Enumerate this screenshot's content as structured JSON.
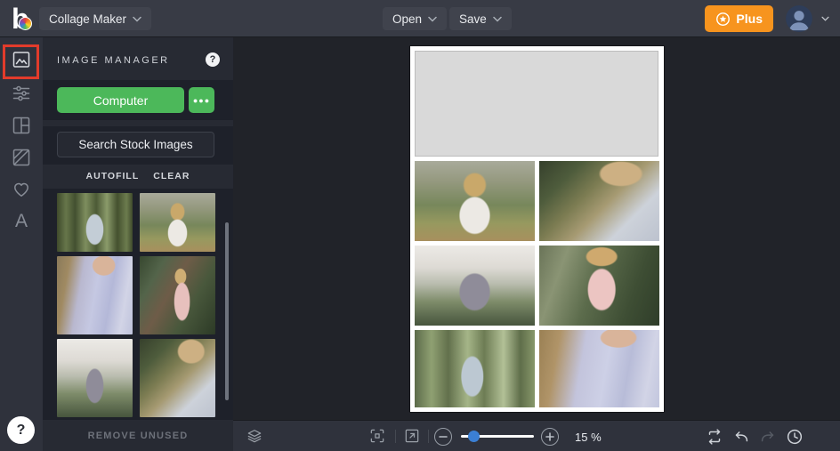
{
  "colors": {
    "accent_green": "#4CB85A",
    "plus_orange": "#F7941E",
    "annotation_red": "#E23B2B",
    "slider_blue": "#3B7FD4",
    "topbar_bg": "#383B45",
    "panel_bg": "#272A33",
    "panel_strip_bg": "#1E212A",
    "canvas_bg": "#212329"
  },
  "topbar": {
    "logo_letter": "b",
    "app_menu_label": "Collage Maker",
    "open_label": "Open",
    "save_label": "Save",
    "plus_label": "Plus"
  },
  "sidebar": {
    "items": [
      {
        "id": "image-manager",
        "active": true
      },
      {
        "id": "edit-adjust",
        "active": false
      },
      {
        "id": "layouts",
        "active": false
      },
      {
        "id": "backgrounds",
        "active": false
      },
      {
        "id": "graphics",
        "active": false
      },
      {
        "id": "text",
        "active": false,
        "glyph": "A"
      }
    ],
    "help_label": "?"
  },
  "image_manager": {
    "title": "IMAGE MANAGER",
    "help_label": "?",
    "computer_label": "Computer",
    "more_label": "●●●",
    "search_stock_label": "Search Stock Images",
    "autofill_label": "AUTOFILL",
    "clear_label": "CLEAR",
    "remove_unused_label": "REMOVE UNUSED",
    "thumbnails": [
      {
        "label": "woman-pale-blue-dress-in-forest",
        "style": "background:radial-gradient(ellipse 20% 45% at 50% 62%, #c3cdd6 0%, #c3cdd6 55%, rgba(195,205,214,0) 60%), linear-gradient(90deg, #3f4a2c 0%, #66764a 12%, #435030 24%, #7e8e5e 38%, #4c5a36 52%, #8a9a6a 66%, #44512f 80%, #6c7c4e 92%, #3f4a2c 100%)"
      },
      {
        "label": "blonde-woman-white-dress-field",
        "style": "background:radial-gradient(ellipse 22% 40% at 50% 68%, #ece9e4 0%, #ece9e4 55%, rgba(236,233,228,0) 60%), radial-gradient(ellipse 10% 16% at 50% 32%, #c9a86a 0%, #c9a86a 85%, rgba(201,168,106,0) 100%), linear-gradient(180deg, #a8aa9a 0%, #95997f 25%, #77875b 55%, #97995f 78%, #a8905e 100%)"
      },
      {
        "label": "lavender-off-shoulder-dress-back",
        "style": "background:radial-gradient(ellipse 26% 22% at 62% 12%, #d9b49a 0%, #d9b49a 55%, rgba(217,180,154,0) 60%), linear-gradient(100deg, #8a7a5a 0%, #a08a62 15%, #b9b8cf 32%, #c5c8e2 50%, #b4b8d8 68%, #d2d4e6 85%, #bfc3dc 100%)"
      },
      {
        "label": "blonde-woman-pink-dress-greenery",
        "style": "background:radial-gradient(ellipse 18% 42% at 56% 58%, #e7c0bd 0%, #e7c0bd 55%, rgba(231,192,189,0) 60%), radial-gradient(ellipse 12% 16% at 54% 26%, #cfae74 0%, #cfae74 60%, rgba(207,174,116,0) 66%), linear-gradient(120deg, #37472f 0%, #53644a 22%, #6e5c48 42%, #49583c 66%, #2c3a26 100%)"
      },
      {
        "label": "woman-gray-dress-under-white-dome",
        "style": "background:radial-gradient(ellipse 20% 38% at 50% 60%, #8f8c99 0%, #8f8c99 55%, rgba(143,140,153,0) 60%), linear-gradient(180deg, #eceae6 0%, #dddad4 28%, #b9bcae 48%, #7e8c6a 70%, #47553d 100%)"
      },
      {
        "label": "crossed-arms-lace-sleeves-white-dress",
        "style": "background:radial-gradient(ellipse 30% 26% at 68% 16%, #cdb083 0%, #cdb083 55%, rgba(205,176,131,0) 62%), linear-gradient(135deg, #36402c 0%, #4e5c3c 22%, #7c7c52 40%, #a69a72 55%, #cdd2da 75%, #bcc2ce 100%)"
      }
    ]
  },
  "canvas": {
    "collage": {
      "placeholder_label": "empty-image-slot",
      "cells": [
        {
          "label": "blonde-woman-white-dress-field",
          "style": "background:radial-gradient(ellipse 22% 40% at 50% 68%, #ece9e4 0%, #ece9e4 55%, rgba(236,233,228,0) 60%), radial-gradient(ellipse 10% 16% at 50% 30%, #c9a86a 0%, #c9a86a 85%, rgba(201,168,106,0) 100%), linear-gradient(180deg, #a8aa9a 0%, #95997f 25%, #77875b 55%, #97995f 78%, #a8905e 100%)"
        },
        {
          "label": "crossed-arms-lace-sleeves-white-dress",
          "style": "background:radial-gradient(ellipse 30% 26% at 68% 16%, #cdb083 0%, #cdb083 55%, rgba(205,176,131,0) 62%), linear-gradient(135deg, #36402c 0%, #4e5c3c 22%, #7c7c52 40%, #a69a72 55%, #cdd2da 75%, #bcc2ce 100%)"
        },
        {
          "label": "woman-gray-dress-under-white-dome",
          "style": "background:radial-gradient(ellipse 22% 40% at 50% 58%, #8f8c99 0%, #8f8c99 55%, rgba(143,140,153,0) 60%), linear-gradient(180deg, #eceae6 0%, #dddad4 28%, #b9bcae 48%, #7e8c6a 70%, #47553d 100%)"
        },
        {
          "label": "blonde-woman-pink-dress-back-garden",
          "style": "background:radial-gradient(ellipse 22% 20% at 52% 14%, #cfa96e 0%, #cfa96e 55%, rgba(207,169,110,0) 62%), radial-gradient(ellipse 20% 45% at 52% 55%, #ecc5c2 0%, #ecc5c2 55%, rgba(236,197,194,0) 60%), linear-gradient(110deg, #6a7458 0%, #8a9474 20%, #5c6c4c 45%, #3e4e34 75%, #2f3d29 100%)"
        },
        {
          "label": "woman-pale-blue-dress-in-forest",
          "style": "background:radial-gradient(ellipse 16% 45% at 48% 60%, #bcc8d2 0%, #bcc8d2 55%, rgba(188,200,210,0) 60%), linear-gradient(90deg, #5c6b4a 0%, #8fa072 14%, #62704c 28%, #a5b588 44%, #6d7c54 58%, #b2c096 74%, #5f6e4a 88%, #87976a 100%)"
        },
        {
          "label": "lavender-off-shoulder-dress-street",
          "style": "background:radial-gradient(ellipse 26% 22% at 66% 10%, #d9b49a 0%, #d9b49a 55%, rgba(217,180,154,0) 60%), linear-gradient(100deg, #9a8054 0%, #b09468 16%, #c3c4dc 36%, #cdd0e6 55%, #b8bcd8 72%, #d2d4e6 88%, #c2c6de 100%)"
        }
      ]
    }
  },
  "toolbar": {
    "zoom_value": "15 %"
  }
}
